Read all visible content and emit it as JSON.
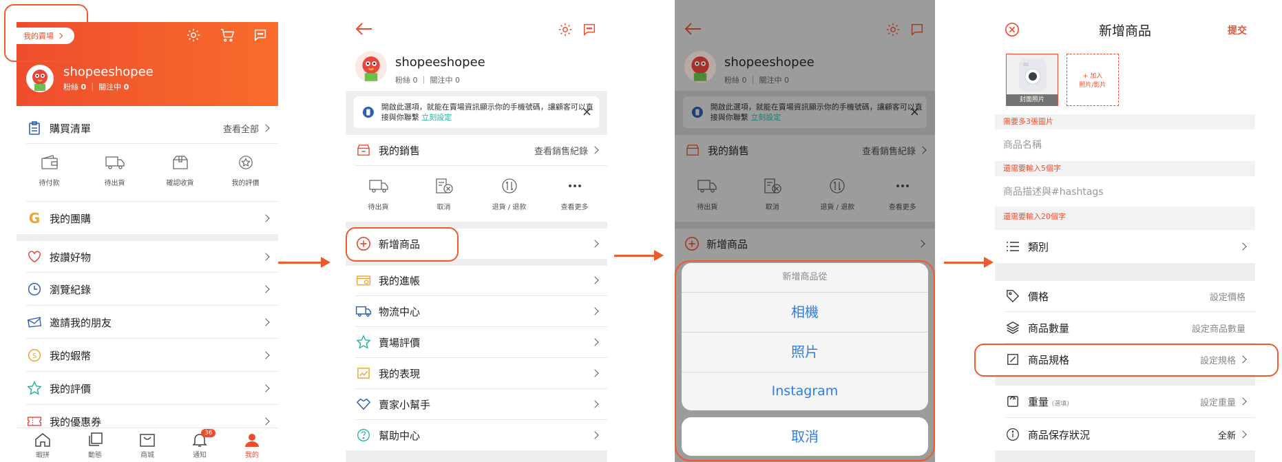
{
  "screen1": {
    "my_shop_btn": "我的賣場",
    "username": "shopeeshopee",
    "followers_label": "粉絲",
    "followers_count": "0",
    "following_label": "關注中",
    "following_count": "0",
    "purchase_list": "購買清單",
    "view_all": "查看全部",
    "order_states": [
      "待付款",
      "待出貨",
      "確認收貨",
      "我的評價"
    ],
    "menu": [
      "我的團購",
      "按讚好物",
      "瀏覽紀錄",
      "邀請我的朋友",
      "我的蝦幣",
      "我的評價",
      "我的優惠券"
    ],
    "tabs": [
      "蝦拼",
      "動態",
      "商城",
      "通知",
      "我的"
    ],
    "notification_badge": "36",
    "colors": {
      "brand": "#ee4d2d",
      "header_gradient_end": "#f96c2c"
    }
  },
  "screen2": {
    "username": "shopeeshopee",
    "followers_label": "粉絲",
    "followers_count": "0",
    "following_label": "關注中",
    "following_count": "0",
    "notice_text": "開啟此選項，就能在賣場資訊顯示你的手機號碼，讓顧客可以直接與你聯繫",
    "notice_link": "立刻設定",
    "my_sales": "我的銷售",
    "view_sales": "查看銷售紀錄",
    "sales_states": [
      "待出貨",
      "取消",
      "退貨 / 退款",
      "查看更多"
    ],
    "add_product": "新增商品",
    "menu": [
      "我的進帳",
      "物流中心",
      "賣場評價",
      "我的表現",
      "賣家小幫手",
      "幫助中心"
    ]
  },
  "screen3": {
    "username": "shopeeshopee",
    "followers_label": "粉絲",
    "followers_count": "0",
    "following_label": "關注中",
    "following_count": "0",
    "notice_text": "開啟此選項，就能在賣場資訊顯示你的手機號碼，讓顧客可以直接與你聯繫",
    "notice_link": "立刻設定",
    "my_sales": "我的銷售",
    "view_sales": "查看銷售紀錄",
    "sales_states": [
      "待出貨",
      "取消",
      "退貨 / 退款",
      "查看更多"
    ],
    "add_product": "新增商品",
    "sheet_title": "新增商品從",
    "sheet_options": [
      "相機",
      "照片",
      "Instagram"
    ],
    "sheet_cancel": "取消"
  },
  "screen4": {
    "title": "新增商品",
    "submit": "提交",
    "cover_label": "封面照片",
    "add_photo_line1": "+ 加入",
    "add_photo_line2": "照片/影片",
    "hint_photos": "需要多3張圖片",
    "name_placeholder": "商品名稱",
    "hint_name": "還需要輸入5個字",
    "desc_placeholder": "商品描述與#hashtags",
    "hint_desc": "還需要輸入20個字",
    "category": "類別",
    "price": "價格",
    "price_value": "設定價格",
    "quantity": "商品數量",
    "quantity_value": "設定商品數量",
    "spec": "商品規格",
    "spec_value": "設定規格",
    "weight": "重量",
    "weight_note": "(選填)",
    "weight_value": "設定重量",
    "condition": "商品保存狀況",
    "condition_value": "全新"
  }
}
